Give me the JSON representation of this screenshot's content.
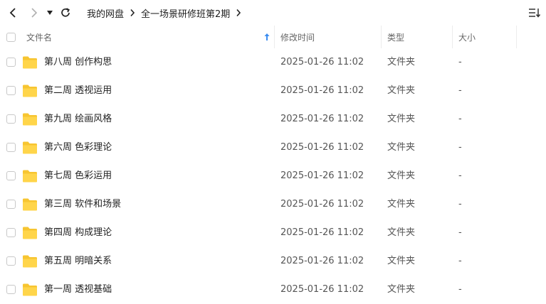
{
  "breadcrumb": [
    "我的网盘",
    "全一场景研修班第2期"
  ],
  "columns": {
    "name": "文件名",
    "mtime": "修改时间",
    "type": "类型",
    "size": "大小"
  },
  "accent_color": "#3b8cf0",
  "folder_color": "#f7c531",
  "files": [
    {
      "name": "第八周 创作构思",
      "mtime": "2025-01-26 11:02",
      "type": "文件夹",
      "size": "-"
    },
    {
      "name": "第二周 透视运用",
      "mtime": "2025-01-26 11:02",
      "type": "文件夹",
      "size": "-"
    },
    {
      "name": "第九周 绘画风格",
      "mtime": "2025-01-26 11:02",
      "type": "文件夹",
      "size": "-"
    },
    {
      "name": "第六周 色彩理论",
      "mtime": "2025-01-26 11:02",
      "type": "文件夹",
      "size": "-"
    },
    {
      "name": "第七周 色彩运用",
      "mtime": "2025-01-26 11:02",
      "type": "文件夹",
      "size": "-"
    },
    {
      "name": "第三周 软件和场景",
      "mtime": "2025-01-26 11:02",
      "type": "文件夹",
      "size": "-"
    },
    {
      "name": "第四周 构成理论",
      "mtime": "2025-01-26 11:02",
      "type": "文件夹",
      "size": "-"
    },
    {
      "name": "第五周 明暗关系",
      "mtime": "2025-01-26 11:02",
      "type": "文件夹",
      "size": "-"
    },
    {
      "name": "第一周 透视基础",
      "mtime": "2025-01-26 11:02",
      "type": "文件夹",
      "size": "-"
    }
  ]
}
